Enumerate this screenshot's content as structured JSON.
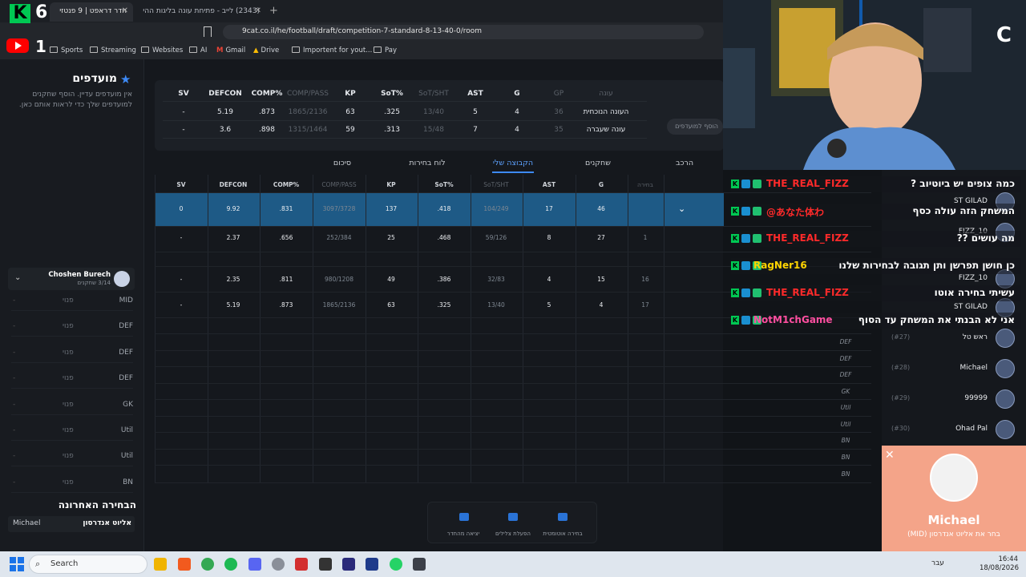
{
  "browser": {
    "tabs": [
      {
        "title": "חדר דראפט | 9 פנטזי",
        "active": true
      },
      {
        "title": "(2343) לייב - פתיחת עונה בליגות ההי",
        "active": false
      }
    ],
    "new_tab": "+",
    "url": "9cat.co.il/he/football/draft/competition-7-standard-8-13-40-0/room",
    "bookmarks": [
      "Sports",
      "Streaming",
      "Websites",
      "AI",
      "Gmail",
      "Drive",
      "Importent for yout...",
      "Pay"
    ]
  },
  "overlay_logo": {
    "k": "K",
    "six": "6",
    "one": "1"
  },
  "favorites": {
    "title": "מועדפים",
    "description": "אין מועדפים עדיין. הוסף שחקנים למועדפים שלך כדי לראות אותם כאן."
  },
  "team": {
    "owner": "Choshen Burech",
    "count": "3/14 שחקנים",
    "slots": [
      {
        "pos": "MID",
        "status": "פנוי",
        "dash": "-"
      },
      {
        "pos": "DEF",
        "status": "פנוי",
        "dash": "-"
      },
      {
        "pos": "DEF",
        "status": "פנוי",
        "dash": "-"
      },
      {
        "pos": "DEF",
        "status": "פנוי",
        "dash": "-"
      },
      {
        "pos": "GK",
        "status": "פנוי",
        "dash": "-"
      },
      {
        "pos": "Util",
        "status": "פנוי",
        "dash": "-"
      },
      {
        "pos": "Util",
        "status": "פנוי",
        "dash": "-"
      },
      {
        "pos": "BN",
        "status": "פנוי",
        "dash": "-"
      }
    ]
  },
  "last_pick": {
    "title": "הבחירה האחרונה",
    "manager": "Michael",
    "player": "אליוט אנדרסון"
  },
  "season_stats": {
    "headers": [
      "SV",
      "DEFCON",
      "COMP%",
      "COMP/PASS",
      "KP",
      "SoT%",
      "SoT/SHT",
      "AST",
      "G",
      "GP",
      "עונה"
    ],
    "rows": [
      [
        "-",
        "5.19",
        ".873",
        "1865/2136",
        "63",
        ".325",
        "13/40",
        "5",
        "4",
        "36",
        "העונה הנוכחית"
      ],
      [
        "-",
        "3.6",
        ".898",
        "1315/1464",
        "59",
        ".313",
        "15/48",
        "7",
        "4",
        "35",
        "עונה שעברה"
      ]
    ],
    "add_favorite": "הוסף למועדפים"
  },
  "tabs": {
    "summary": "סיכום",
    "board": "לוח בחירות",
    "myteam": "הקבוצה שלי",
    "players": "שחקנים",
    "lineup": "הרכב"
  },
  "main_table": {
    "headers": [
      "SV",
      "DEFCON",
      "COMP%",
      "COMP/PASS",
      "KP",
      "SoT%",
      "SoT/SHT",
      "AST",
      "G",
      "בחירה"
    ],
    "rows": [
      [
        "0",
        "9.92",
        ".831",
        "3097/3728",
        "137",
        ".418",
        "104/249",
        "17",
        "46",
        ""
      ],
      [
        "-",
        "2.37",
        ".656",
        "252/384",
        "25",
        ".468",
        "59/126",
        "8",
        "27",
        "1"
      ],
      [
        "",
        "",
        "",
        "",
        "",
        "",
        "",
        "",
        "",
        ""
      ],
      [
        "-",
        "2.35",
        ".811",
        "980/1208",
        "49",
        ".386",
        "32/83",
        "4",
        "15",
        "16"
      ],
      [
        "-",
        "5.19",
        ".873",
        "1865/2136",
        "63",
        ".325",
        "13/40",
        "5",
        "4",
        "17"
      ]
    ],
    "extra_positions": [
      "DEF",
      "DEF",
      "DEF",
      "GK",
      "Util",
      "Util",
      "BN",
      "BN",
      "BN"
    ]
  },
  "bottom_actions": [
    {
      "label": "יציאה מהחדר"
    },
    {
      "label": "הפעלת צלילים"
    },
    {
      "label": "בחירה אוטומטית"
    }
  ],
  "chat": [
    {
      "user": "THE_REAL_FIZZ",
      "msg": "כמה צופים יש ביוטיוב ?",
      "color": "#ff2a2a"
    },
    {
      "user": "@あなた体わ",
      "msg": "המשחק הזה עולה כסף",
      "color": "#ff2a2a"
    },
    {
      "user": "THE_REAL_FIZZ",
      "msg": "מה עושים ??",
      "color": "#ff2a2a"
    },
    {
      "user": "RagNer16",
      "msg": "כן חושן תפרשן ותן תגובה לבחירות שלנו",
      "color": "#ffd400"
    },
    {
      "user": "THE_REAL_FIZZ",
      "msg": "עשיתי בחירה אוטו",
      "color": "#ff2a2a"
    },
    {
      "user": "NotM1chGame",
      "msg": "אני לא הבנתי את המשחק עד הסוף",
      "color": "#ff4fa0"
    }
  ],
  "roster": [
    {
      "num": "",
      "name": "ST GILAD"
    },
    {
      "num": "",
      "name": "FIZZ_10"
    },
    {
      "num": "",
      "name": "FIZZ_10"
    },
    {
      "num": "",
      "name": "ST GILAD"
    },
    {
      "num": "(#27)",
      "name": "ראש טל"
    },
    {
      "num": "(#28)",
      "name": "Michael"
    },
    {
      "num": "(#29)",
      "name": "99999"
    },
    {
      "num": "(#30)",
      "name": "Ohad Pal"
    }
  ],
  "notification": {
    "name": "Michael",
    "text": "בחר את אליוט אנדרסון (MID)"
  },
  "taskbar": {
    "search": "Search",
    "lang": "עבר",
    "time": "16:44",
    "date": "18/08/2026"
  }
}
